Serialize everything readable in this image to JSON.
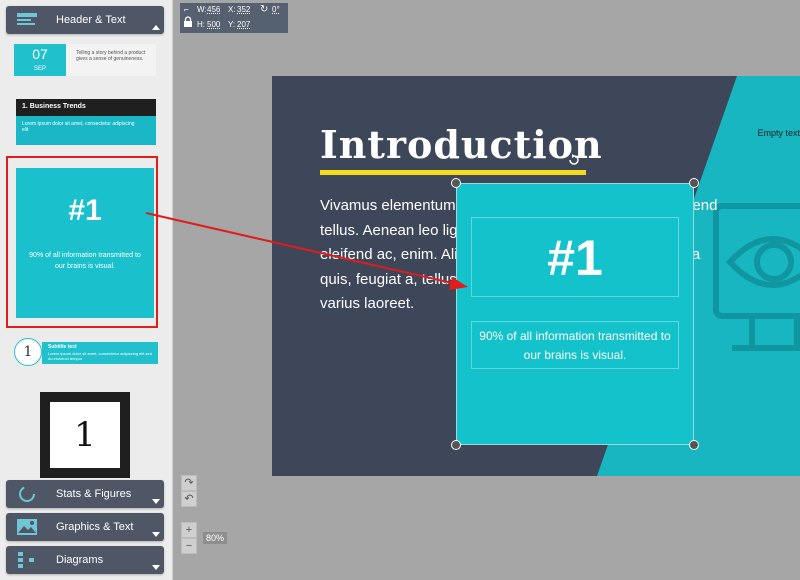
{
  "sidebar": {
    "categories": {
      "header_text": {
        "label": "Header & Text",
        "icon": "text-block-icon",
        "expanded": true
      },
      "stats_figures": {
        "label": "Stats & Figures",
        "icon": "chart-circle-icon"
      },
      "graphics_text": {
        "label": "Graphics & Text",
        "icon": "image-icon"
      },
      "diagrams": {
        "label": "Diagrams",
        "icon": "diagram-icon"
      }
    },
    "thumbs": {
      "date": {
        "day": "07",
        "month": "SEP",
        "text": "Telling a story behind a product gives a sense of genuineness."
      },
      "trends": {
        "title": "1. Business Trends",
        "text": "Lorem ipsum dolor sit amet, consectetur adipiscing elit"
      },
      "number": {
        "big": "#1",
        "small": "90% of all information transmitted to our brains is visual."
      },
      "circle": {
        "num": "1",
        "title": "Subtitle text",
        "text": "Lorem ipsum dolor sit amet, consectetur adipiscing elit sed do eiusmod tempor"
      },
      "square": {
        "num": "1"
      }
    }
  },
  "toolbar": {
    "w_label": "W:",
    "w_value": "456",
    "h_label": "H:",
    "h_value": "500",
    "x_label": "X:",
    "x_value": "352",
    "y_label": "Y:",
    "y_value": "207",
    "rotation": "0°"
  },
  "slide": {
    "title": "Introduction",
    "body": "Vivamus elementum semper nisi. Aenean vulputate eleifend tellus. Aenean leo ligula, porttitor eu, consequat vitae, eleifend ac, enim. Aliquam lorem ante, dapibus in, viverra quis, feugiat a, tellus. Phasellus viverra nulla ut metus varius laoreet.",
    "empty_text": "Empty text",
    "accent_color": "#14c2cc",
    "underline_color": "#f3dc1c"
  },
  "selected_element": {
    "big": "#1",
    "small": "90% of all information transmitted to our brains is visual."
  },
  "zoom": {
    "value": "80%"
  },
  "colors": {
    "highlight_border": "#e21b1b",
    "arrow": "#e21b1b"
  }
}
